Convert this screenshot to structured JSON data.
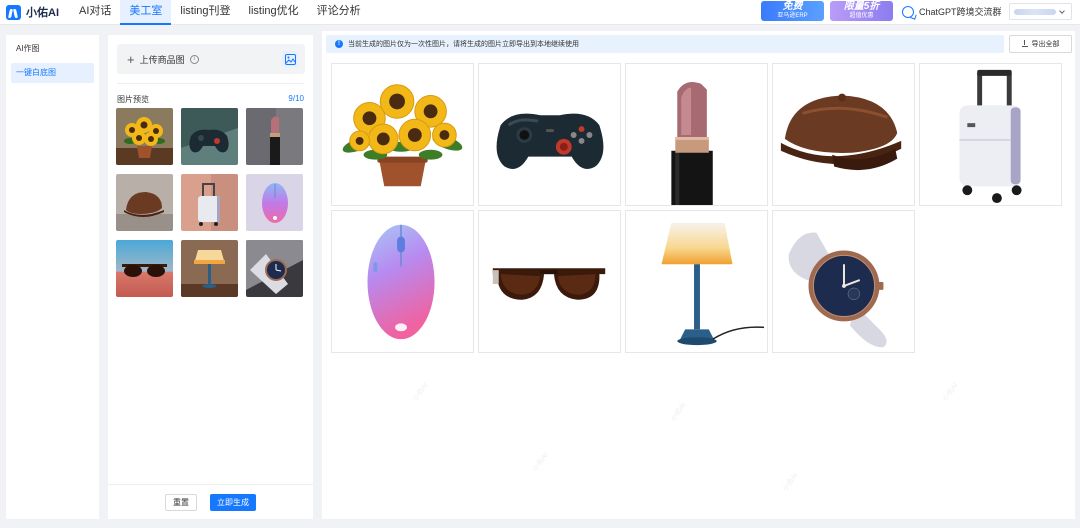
{
  "app": {
    "name": "小佑AI"
  },
  "nav": [
    {
      "label": "AI对话",
      "active": false
    },
    {
      "label": "美工室",
      "active": true
    },
    {
      "label": "listing刊登",
      "active": false
    },
    {
      "label": "listing优化",
      "active": false
    },
    {
      "label": "评论分析",
      "active": false
    }
  ],
  "promos": [
    {
      "big": "免费",
      "small": "亚马逊ERP"
    },
    {
      "big": "限量5折",
      "small": "超值优惠"
    }
  ],
  "chat_link": "ChatGPT跨境交流群",
  "sidebar": [
    {
      "label": "AI作图",
      "active": false
    },
    {
      "label": "一键白底图",
      "active": true
    }
  ],
  "upload": {
    "label": "上传商品图"
  },
  "preview": {
    "title": "图片预览",
    "count": "9/10"
  },
  "buttons": {
    "reset": "重置",
    "generate": "立即生成"
  },
  "notice": "当前生成的图片仅为一次性图片，请将生成的图片立即导出到本地继续使用",
  "export_label": "导出全部",
  "products": [
    "sunflowers",
    "game-controller",
    "lipstick",
    "leather-cap",
    "suitcase",
    "computer-mouse",
    "sunglasses",
    "table-lamp",
    "wristwatch"
  ],
  "colors": {
    "accent": "#1677ff",
    "notice_bg": "#e8f2ff"
  }
}
